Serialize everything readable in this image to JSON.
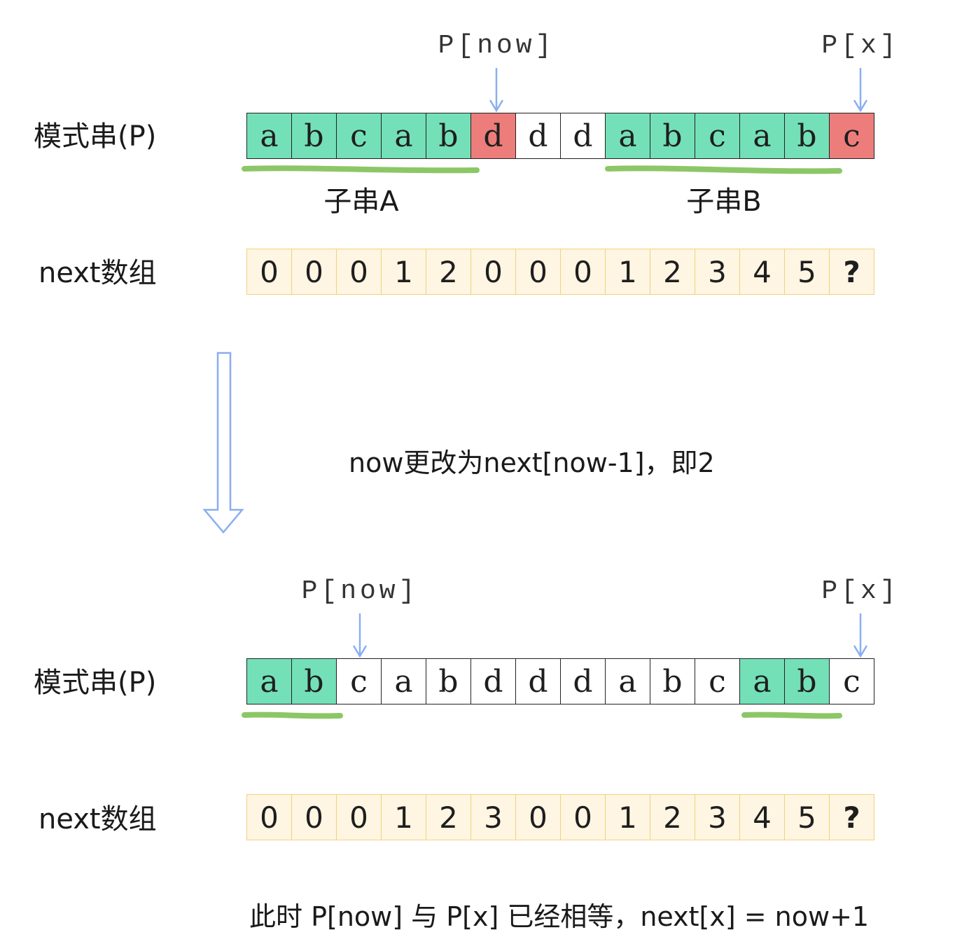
{
  "top": {
    "pattern_label": "模式串(P)",
    "pattern": [
      "a",
      "b",
      "c",
      "a",
      "b",
      "d",
      "d",
      "d",
      "a",
      "b",
      "c",
      "a",
      "b",
      "c"
    ],
    "match": [
      0,
      1,
      2,
      3,
      4,
      8,
      9,
      10,
      11,
      12
    ],
    "red": [
      5,
      13
    ],
    "ptr_now": {
      "text": "P[now]",
      "index": 5
    },
    "ptr_x": {
      "text": "P[x]",
      "index": 13
    },
    "sub_a": "子串A",
    "sub_b": "子串B",
    "next_label": "next数组",
    "next": [
      "0",
      "0",
      "0",
      "1",
      "2",
      "0",
      "0",
      "0",
      "1",
      "2",
      "3",
      "4",
      "5",
      "?"
    ]
  },
  "transition_text": "now更改为next[now-1]，即2",
  "bottom": {
    "pattern_label": "模式串(P)",
    "pattern": [
      "a",
      "b",
      "c",
      "a",
      "b",
      "d",
      "d",
      "d",
      "a",
      "b",
      "c",
      "a",
      "b",
      "c"
    ],
    "match": [
      0,
      1,
      11,
      12
    ],
    "red": [],
    "ptr_now": {
      "text": "P[now]",
      "index": 2
    },
    "ptr_x": {
      "text": "P[x]",
      "index": 13
    },
    "next_label": "next数组",
    "next": [
      "0",
      "0",
      "0",
      "1",
      "2",
      "3",
      "0",
      "0",
      "1",
      "2",
      "3",
      "4",
      "5",
      "?"
    ]
  },
  "conclusion": "此时 P[now] 与 P[x] 已经相等，next[x] = now+1",
  "colors": {
    "match": "#74e0b8",
    "mismatch": "#ec7d7b",
    "next_fill": "#fef5e2",
    "next_border": "#f2d27c",
    "arrow": "#8aaef0",
    "underline": "#8cc766"
  }
}
